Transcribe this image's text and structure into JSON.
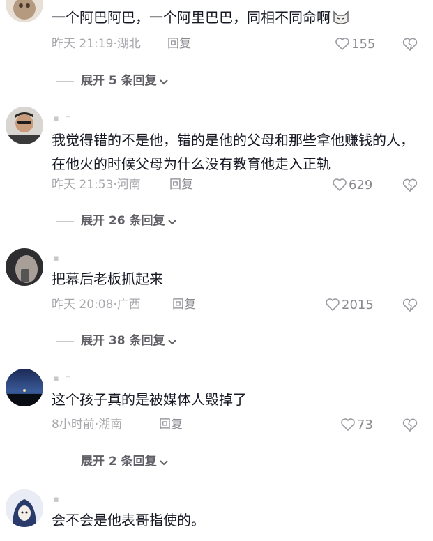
{
  "comments": [
    {
      "username": "",
      "text": "一个阿巴阿巴，一个阿里巴巴，同相不同命啊",
      "time": "昨天 21:19",
      "location": "湖北",
      "reply_label": "回复",
      "likes": "155",
      "expand_label": "展开 5 条回复"
    },
    {
      "username": "▪ ▫",
      "text": "我觉得错的不是他，错的是他的父母和那些拿他赚钱的人，在他火的时候父母为什么没有教育他走入正轨",
      "time": "昨天 21:53",
      "location": "河南",
      "reply_label": "回复",
      "likes": "629",
      "expand_label": "展开 26 条回复"
    },
    {
      "username": "▪",
      "text": "把幕后老板抓起来",
      "time": "昨天 20:08",
      "location": "广西",
      "reply_label": "回复",
      "likes": "2015",
      "expand_label": "展开 38 条回复"
    },
    {
      "username": "▪ ▫",
      "text": "这个孩子真的是被媒体人毁掉了",
      "time": "8小时前",
      "location": "湖南",
      "reply_label": "回复",
      "likes": "73",
      "expand_label": "展开 2 条回复"
    },
    {
      "username": "▪",
      "text": "会不会是他表哥指使的。"
    }
  ],
  "icons": {
    "like": "heart-outline-icon",
    "dislike": "broken-heart-icon",
    "expand": "chevron-down-icon",
    "emoji": "cat-emoji-icon"
  },
  "colors": {
    "text": "#161823",
    "meta": "#a8a8ad",
    "secondary": "#8a8a90"
  }
}
